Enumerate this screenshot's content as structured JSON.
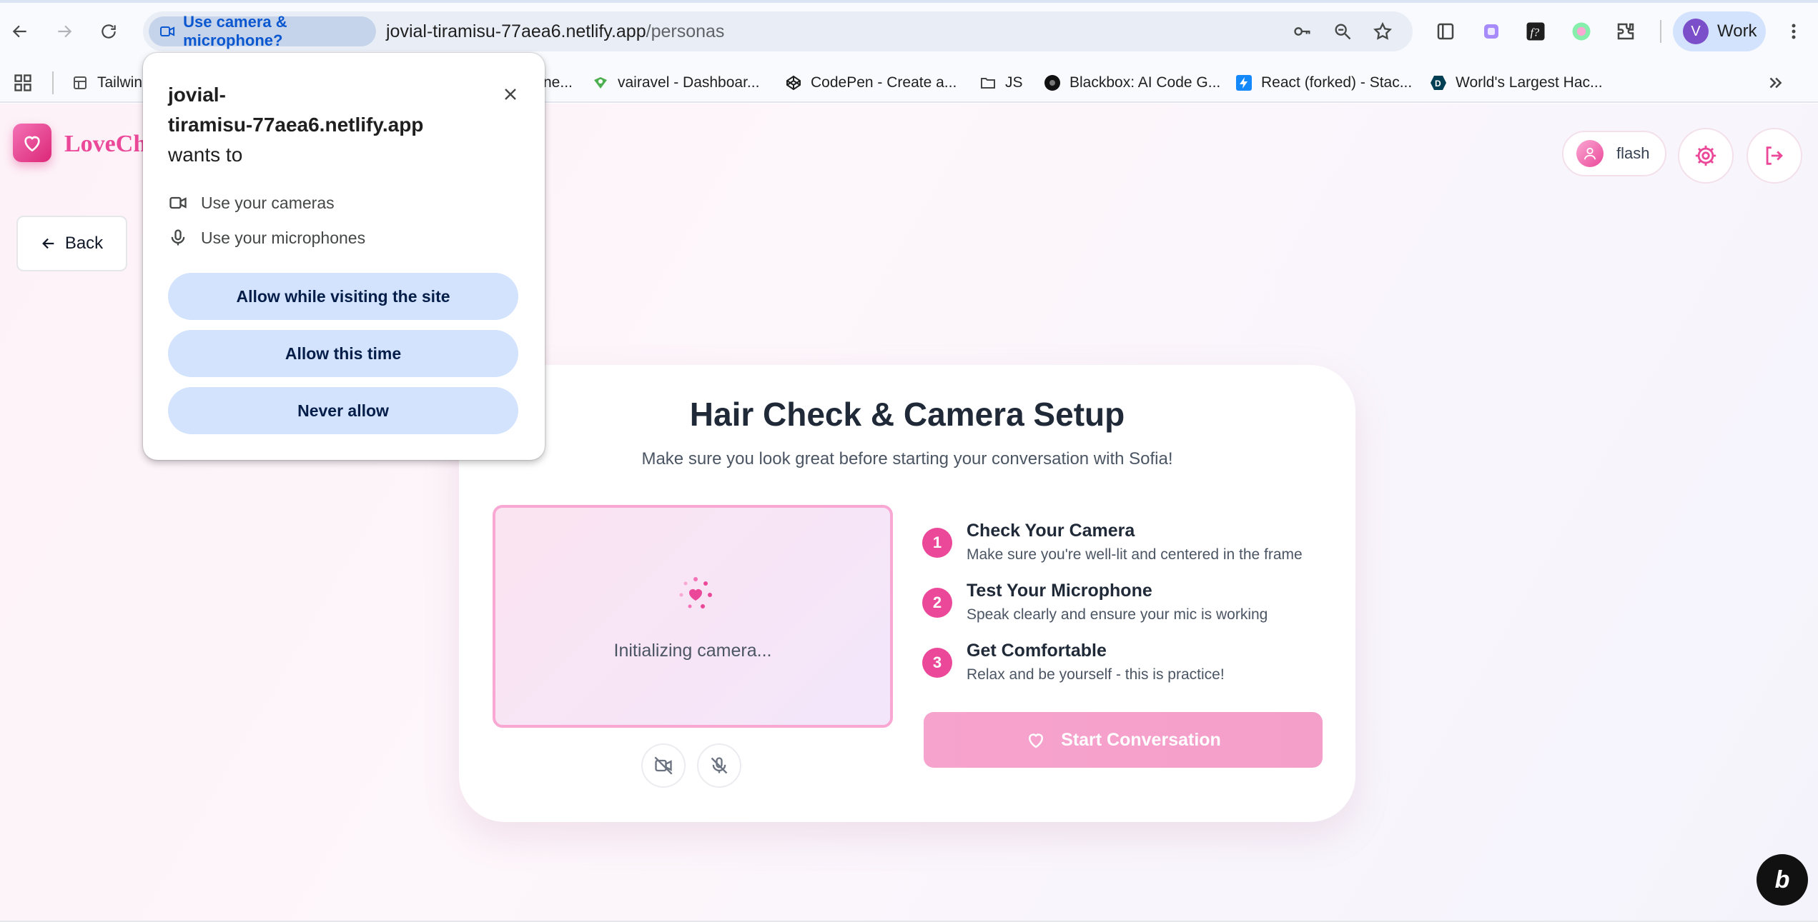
{
  "browser": {
    "permission_chip": "Use camera & microphone?",
    "url_host": "jovial-tiramisu-77aea6.netlify.app",
    "url_path": "/personas",
    "profile_initial": "V",
    "profile_label": "Work"
  },
  "bookmarks": [
    {
      "label": "Tailwin",
      "icon": "tailwind-icon"
    },
    {
      "label": "vairavel - Dashboar...",
      "icon": "codeium-icon"
    },
    {
      "label": "CodePen - Create a...",
      "icon": "codepen-icon"
    },
    {
      "label": "JS",
      "icon": "folder-icon"
    },
    {
      "label": "Blackbox: AI Code G...",
      "icon": "blackbox-icon"
    },
    {
      "label": "React (forked) - Stac...",
      "icon": "stackblitz-icon"
    },
    {
      "label": "World's Largest Hac...",
      "icon": "devpost-icon"
    }
  ],
  "bookmark_partial": "ne...",
  "app": {
    "logo_text": "LoveCh",
    "back_label": "Back",
    "user_name": "flash"
  },
  "card": {
    "title": "Hair Check & Camera Setup",
    "subtitle": "Make sure you look great before starting your conversation with Sofia!",
    "preview_status": "Initializing camera...",
    "steps": [
      {
        "num": "1",
        "title": "Check Your Camera",
        "desc": "Make sure you're well-lit and centered in the frame"
      },
      {
        "num": "2",
        "title": "Test Your Microphone",
        "desc": "Speak clearly and ensure your mic is working"
      },
      {
        "num": "3",
        "title": "Get Comfortable",
        "desc": "Relax and be yourself - this is practice!"
      }
    ],
    "start_label": "Start Conversation"
  },
  "popup": {
    "title_host_line1": "jovial-",
    "title_host_line2": "tiramisu-77aea6.netlify.app",
    "title_suffix": "wants to",
    "perm_camera": "Use your cameras",
    "perm_mic": "Use your microphones",
    "btn_allow_visit": "Allow while visiting the site",
    "btn_allow_once": "Allow this time",
    "btn_never": "Never allow"
  },
  "colors": {
    "accent": "#ec4899",
    "chrome_blue": "#0b57d0",
    "popup_button": "#d3e3fd"
  }
}
